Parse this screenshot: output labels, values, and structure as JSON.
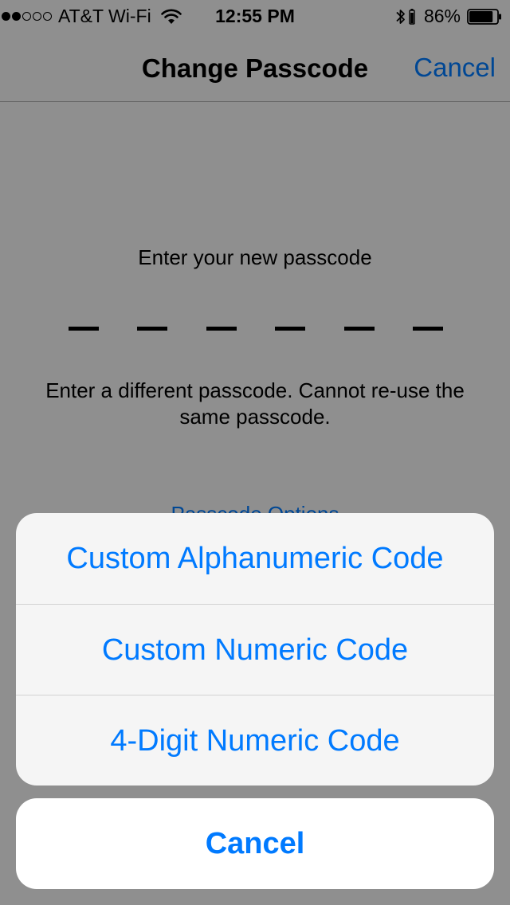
{
  "status_bar": {
    "signal": {
      "filled": 2,
      "total": 5
    },
    "carrier": "AT&T Wi-Fi",
    "wifi_icon": "wifi-icon",
    "time": "12:55 PM",
    "bluetooth_icon": "bluetooth-icon",
    "battery_percent": "86%",
    "battery_level": 0.86
  },
  "nav": {
    "title": "Change Passcode",
    "cancel_label": "Cancel"
  },
  "passcode": {
    "prompt": "Enter your new passcode",
    "digit_count": 6,
    "error": "Enter a different passcode. Cannot re-use the same passcode.",
    "options_link": "Passcode Options"
  },
  "action_sheet": {
    "options": [
      "Custom Alphanumeric Code",
      "Custom Numeric Code",
      "4-Digit Numeric Code"
    ],
    "cancel_label": "Cancel"
  },
  "colors": {
    "accent": "#007aff",
    "overlay": "rgba(0,0,0,0.42)"
  }
}
